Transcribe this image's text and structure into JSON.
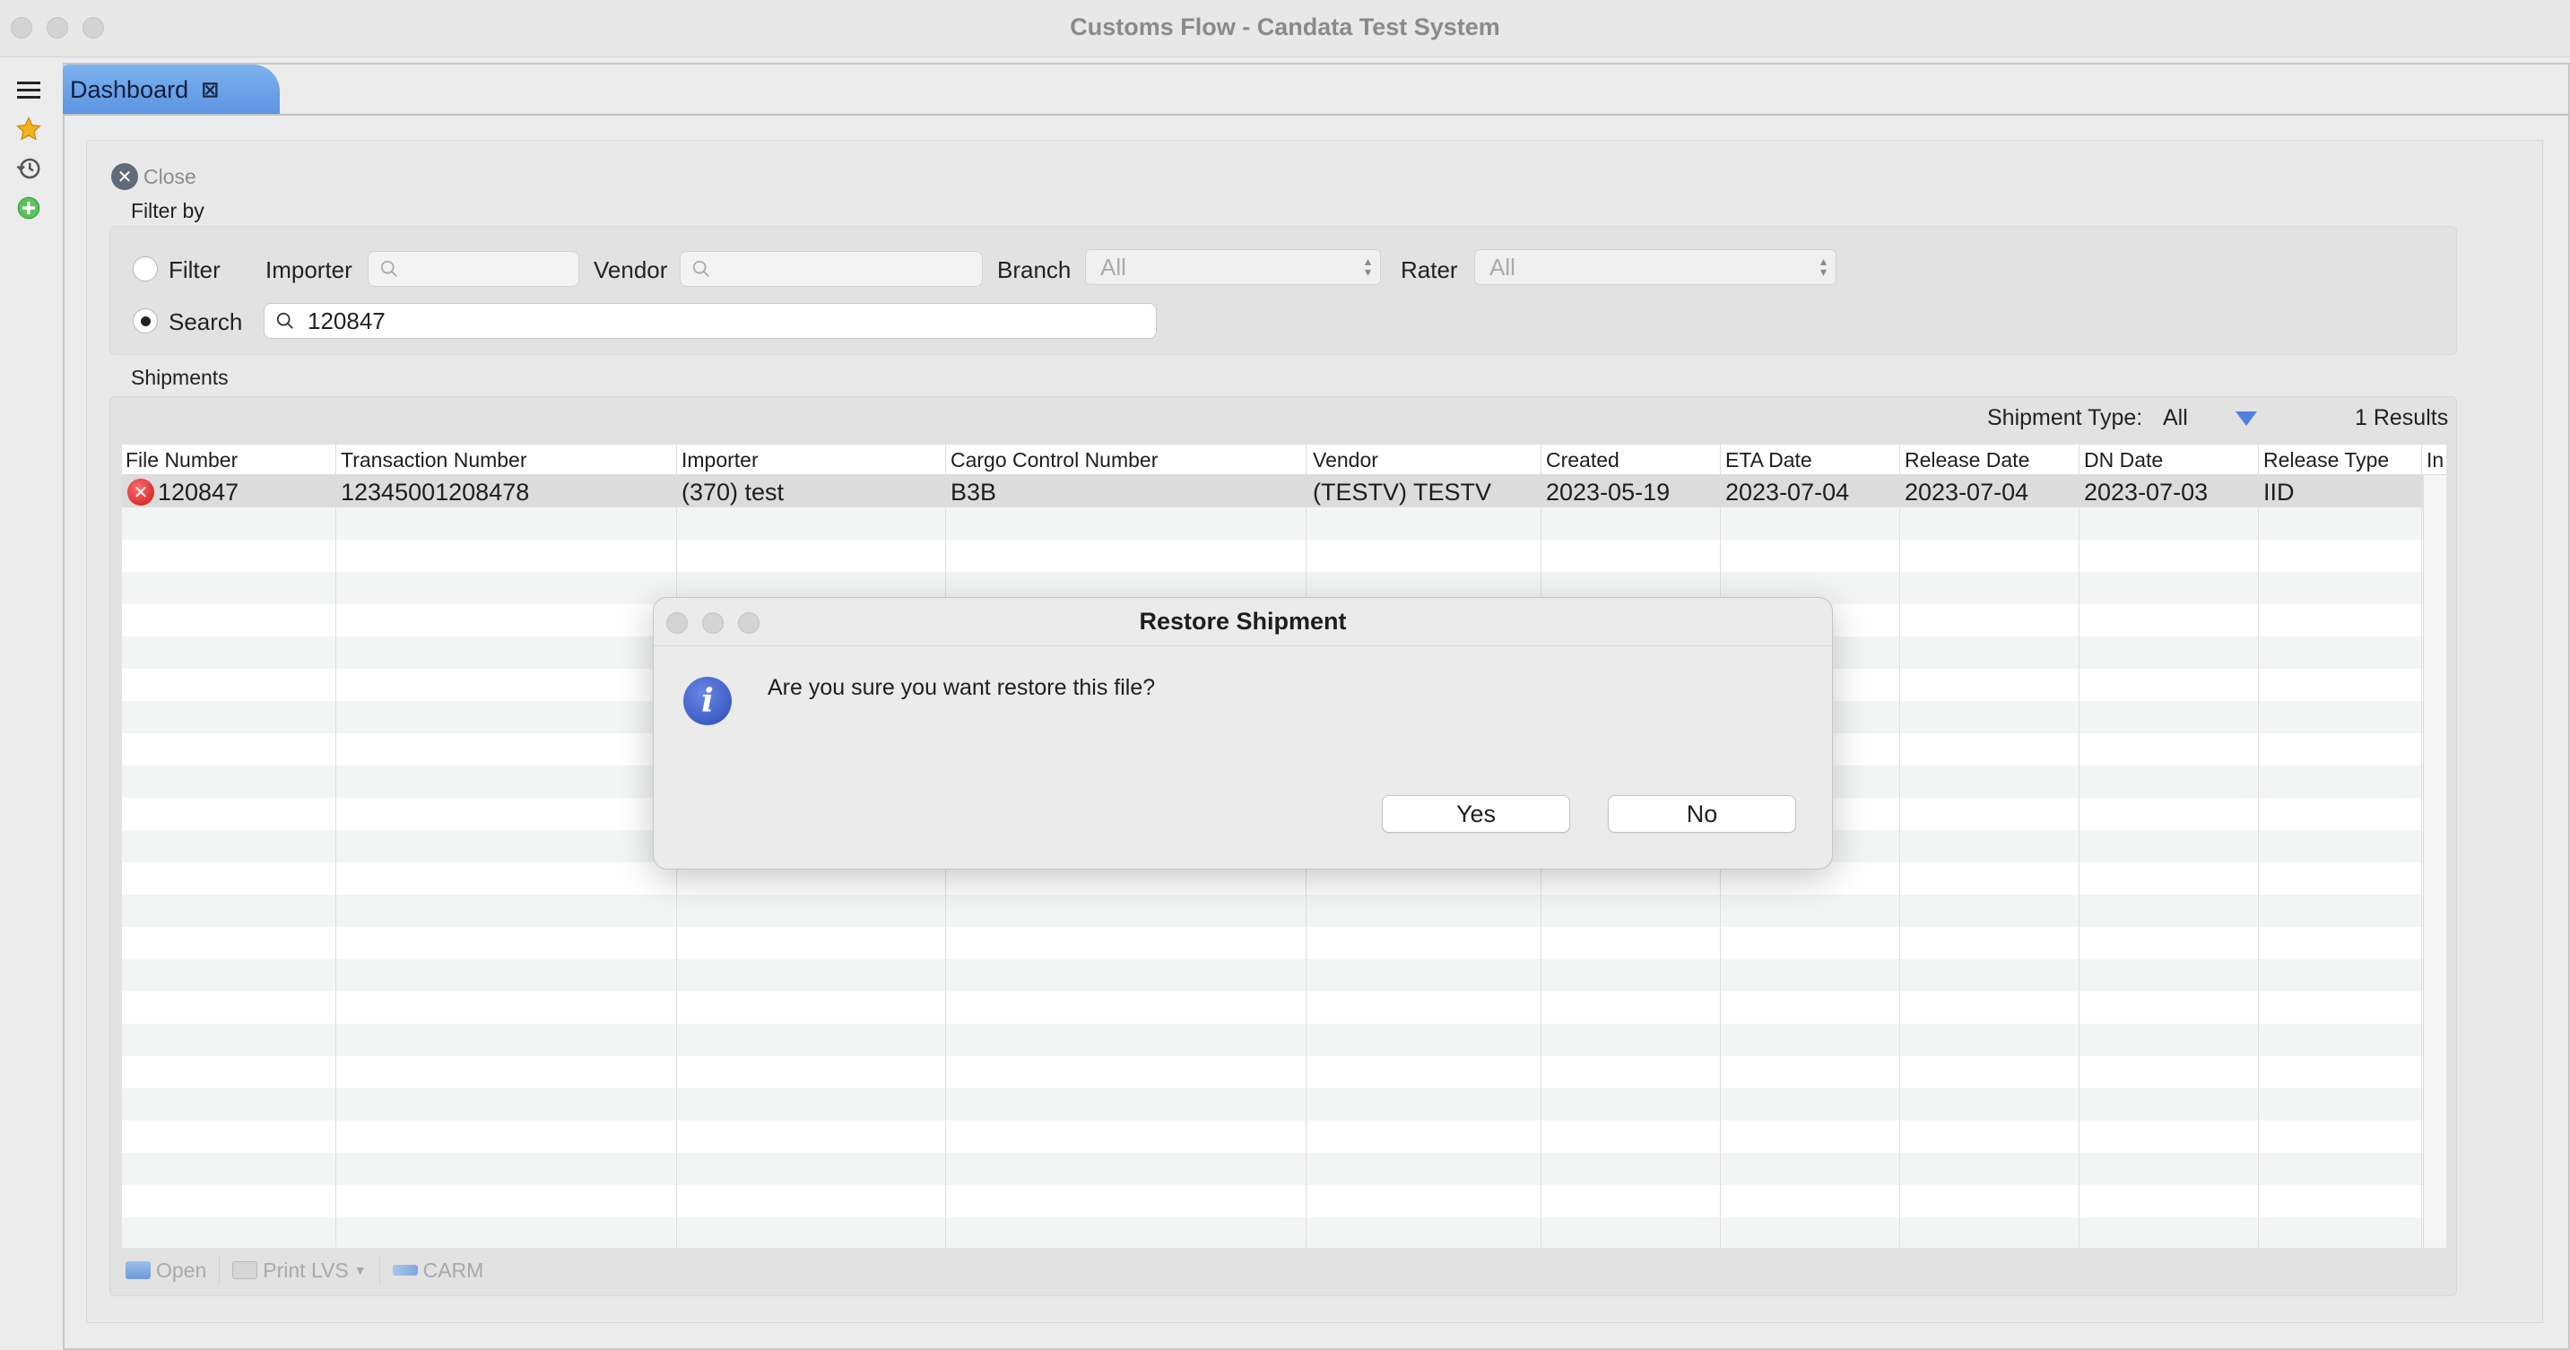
{
  "window": {
    "title": "Customs Flow - Candata Test System"
  },
  "tab": {
    "label": "Dashboard",
    "close_glyph": "⊠"
  },
  "panel": {
    "close_label": "Close",
    "filter_by_label": "Filter by",
    "shipments_label": "Shipments"
  },
  "filter": {
    "filter_radio_label": "Filter",
    "search_radio_label": "Search",
    "selected_mode": "Search",
    "importer_label": "Importer",
    "importer_value": "",
    "vendor_label": "Vendor",
    "vendor_value": "",
    "branch_label": "Branch",
    "branch_value": "All",
    "rater_label": "Rater",
    "rater_value": "All",
    "search_value": "120847"
  },
  "shipments": {
    "type_label": "Shipment Type:",
    "type_value": "All",
    "results_text": "1 Results",
    "columns": [
      "File Number",
      "Transaction Number",
      "Importer",
      "Cargo Control Number",
      "Vendor",
      "Created",
      "ETA Date",
      "Release Date",
      "DN Date",
      "Release Type",
      "In"
    ],
    "rows": [
      {
        "file_number": "120847",
        "transaction_number": "12345001208478",
        "importer": "(370) test",
        "cargo_control_number": "B3B",
        "vendor": "(TESTV) TESTV",
        "created": "2023-05-19",
        "eta_date": "2023-07-04",
        "release_date": "2023-07-04",
        "dn_date": "2023-07-03",
        "release_type": "IID",
        "status_icon": "error-icon"
      }
    ]
  },
  "toolbar": {
    "open_label": "Open",
    "print_label": "Print LVS",
    "carm_label": "CARM"
  },
  "dialog": {
    "title": "Restore Shipment",
    "message": "Are you sure you want restore this file?",
    "yes_label": "Yes",
    "no_label": "No",
    "icon": "info-icon"
  },
  "colors": {
    "tab_accent": "#5c94e0",
    "error_red": "#c81919",
    "info_blue": "#2b4db8"
  }
}
